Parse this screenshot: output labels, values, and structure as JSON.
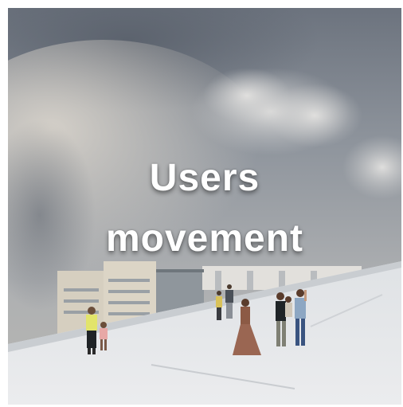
{
  "caption": {
    "line1": "Users",
    "line2": "movement"
  },
  "colors": {
    "sky_dark": "#6f7682",
    "sky_mid": "#9aa0a8",
    "sky_light": "#c9c8c4",
    "ramp_surface": "#e6e8ea",
    "building": "#d9d2c2",
    "text": "#ffffff"
  }
}
